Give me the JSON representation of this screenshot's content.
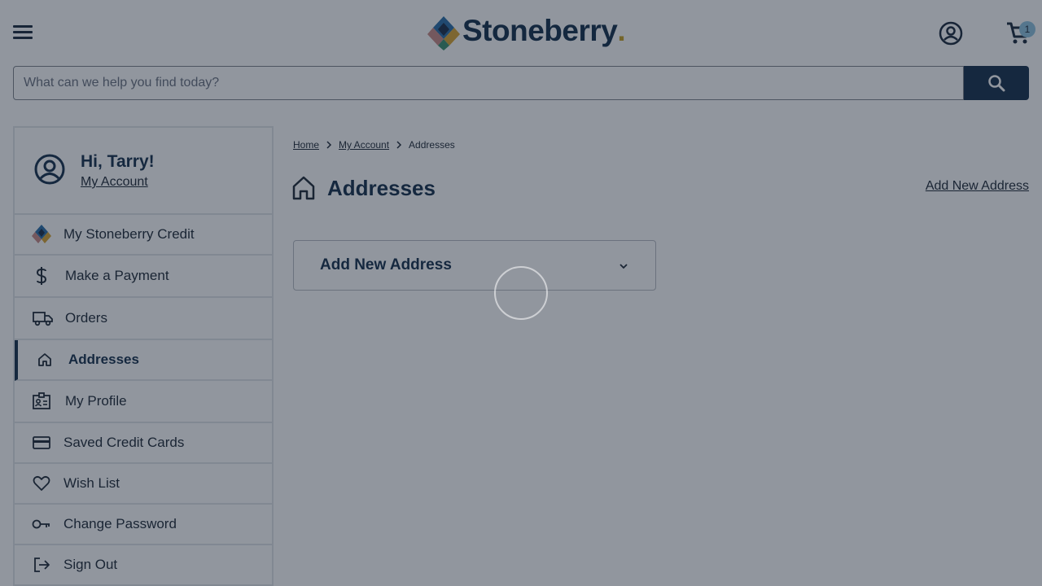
{
  "header": {
    "logo_text": "Stoneberry",
    "logo_dot": ".",
    "cart_count": "1"
  },
  "search": {
    "placeholder": "What can we help you find today?",
    "value": ""
  },
  "sidebar": {
    "greeting": "Hi, Tarry!",
    "account_link": "My Account",
    "items": [
      {
        "label": "My Stoneberry Credit",
        "icon": "stoneberry-logo-icon"
      },
      {
        "label": "Make a Payment",
        "icon": "dollar-icon"
      },
      {
        "label": "Orders",
        "icon": "truck-icon"
      },
      {
        "label": "Addresses",
        "icon": "home-icon",
        "active": true
      },
      {
        "label": "My Profile",
        "icon": "profile-card-icon"
      },
      {
        "label": "Saved Credit Cards",
        "icon": "credit-card-icon"
      },
      {
        "label": "Wish List",
        "icon": "heart-icon"
      },
      {
        "label": "Change Password",
        "icon": "key-icon"
      },
      {
        "label": "Sign Out",
        "icon": "sign-out-icon"
      }
    ]
  },
  "breadcrumb": {
    "home": "Home",
    "account": "My Account",
    "current": "Addresses"
  },
  "main": {
    "title": "Addresses",
    "add_link": "Add New Address",
    "accordion_label": "Add New Address"
  },
  "colors": {
    "brand_navy": "#15304d",
    "overlay": "rgba(22,32,48,0.47)",
    "badge": "#8fc3df"
  }
}
